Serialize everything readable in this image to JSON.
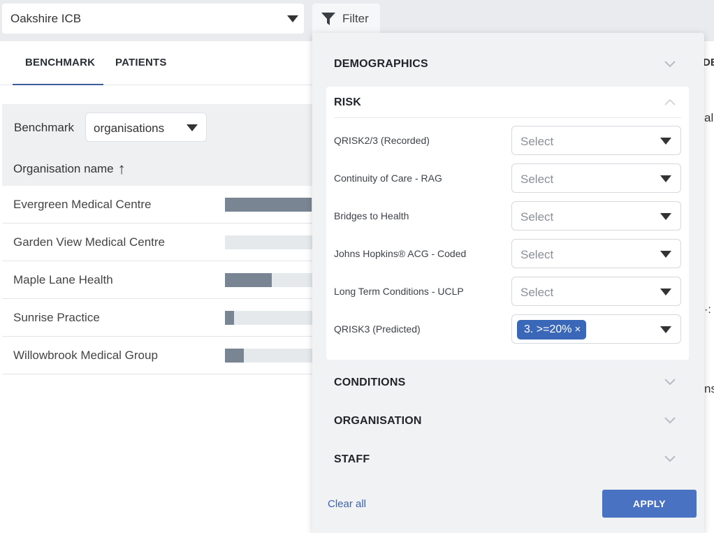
{
  "header": {
    "org_select_value": "Oakshire ICB",
    "filter_button_label": "Filter"
  },
  "tabs": [
    {
      "label": "BENCHMARK",
      "active": true
    },
    {
      "label": "PATIENTS",
      "active": false
    }
  ],
  "benchmark": {
    "label": "Benchmark",
    "select_value": "organisations",
    "column_header": "Organisation name",
    "sort_icon": "arrow-up-icon",
    "rows": [
      {
        "name": "Evergreen Medical Centre",
        "level": 0.97
      },
      {
        "name": "Garden View Medical Centre",
        "level": 0.0
      },
      {
        "name": "Maple Lane Health",
        "level": 0.52
      },
      {
        "name": "Sunrise Practice",
        "level": 0.1
      },
      {
        "name": "Willowbrook Medical Group",
        "level": 0.21
      }
    ],
    "bar_color": "#7a8593",
    "track_color": "#e6e9ec"
  },
  "right_strip": {
    "fragments": [
      "DE",
      "al",
      "·:",
      "ns"
    ]
  },
  "filter_panel": {
    "sections": {
      "demographics": "DEMOGRAPHICS",
      "risk": "RISK",
      "conditions": "CONDITIONS",
      "organisation": "ORGANISATION",
      "staff": "STAFF"
    },
    "risk_filters": [
      {
        "label": "QRISK2/3 (Recorded)",
        "placeholder": "Select"
      },
      {
        "label": "Continuity of Care - RAG",
        "placeholder": "Select"
      },
      {
        "label": "Bridges to Health",
        "placeholder": "Select"
      },
      {
        "label": "Johns Hopkins® ACG - Coded",
        "placeholder": "Select"
      },
      {
        "label": "Long Term Conditions - UCLP",
        "placeholder": "Select"
      },
      {
        "label": "QRISK3 (Predicted)",
        "chip": "3. >=20%",
        "chip_remove": "×"
      }
    ],
    "clear_all_label": "Clear all",
    "apply_label": "APPLY",
    "accent_color": "#4a72c2"
  }
}
